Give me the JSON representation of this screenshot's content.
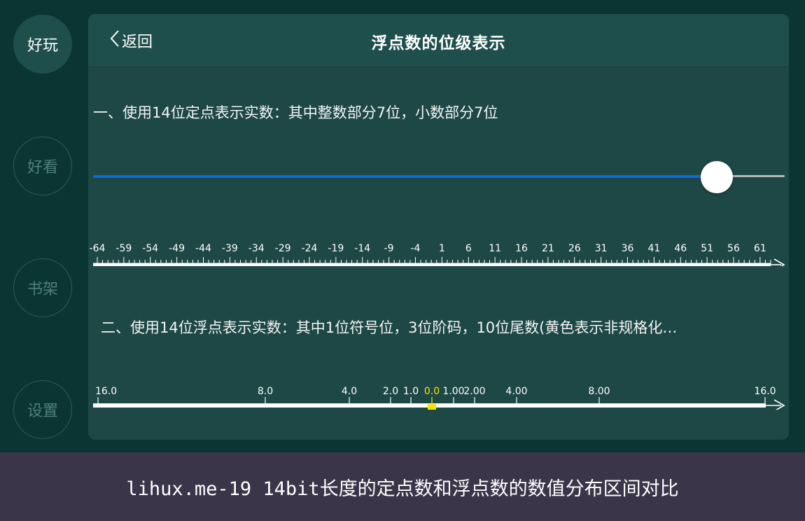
{
  "sidebar": {
    "items": [
      {
        "label": "好玩",
        "active": true
      },
      {
        "label": "好看",
        "active": false
      },
      {
        "label": "书架",
        "active": false
      },
      {
        "label": "设置",
        "active": false
      }
    ]
  },
  "header": {
    "back_label": "返回",
    "title": "浮点数的位级表示"
  },
  "fixed_point": {
    "title": "一、使用14位定点表示实数：其中整数部分7位，小数部分7位",
    "slider_value_fraction": 0.902,
    "tick_labels": [
      "-64",
      "-59",
      "-54",
      "-49",
      "-44",
      "-39",
      "-34",
      "-29",
      "-24",
      "-19",
      "-14",
      "-9",
      "-4",
      "1",
      "6",
      "11",
      "16",
      "21",
      "26",
      "31",
      "36",
      "41",
      "46",
      "51",
      "56",
      "61"
    ]
  },
  "floating_point": {
    "title": "二、使用14位浮点表示实数：其中1位符号位，3位阶码，10位尾数(黄色表示非规格化…",
    "tick_labels": [
      "16.0",
      "8.0",
      "4.0",
      "2.0",
      "1.0",
      "0.0",
      "1.00",
      "2.00",
      "4.00",
      "8.00",
      "16.0"
    ],
    "highlight_label": "0.0",
    "highlight_color": "#f2e600"
  },
  "caption": "lihux.me-19 14bit长度的定点数和浮点数的数值分布区间对比"
}
